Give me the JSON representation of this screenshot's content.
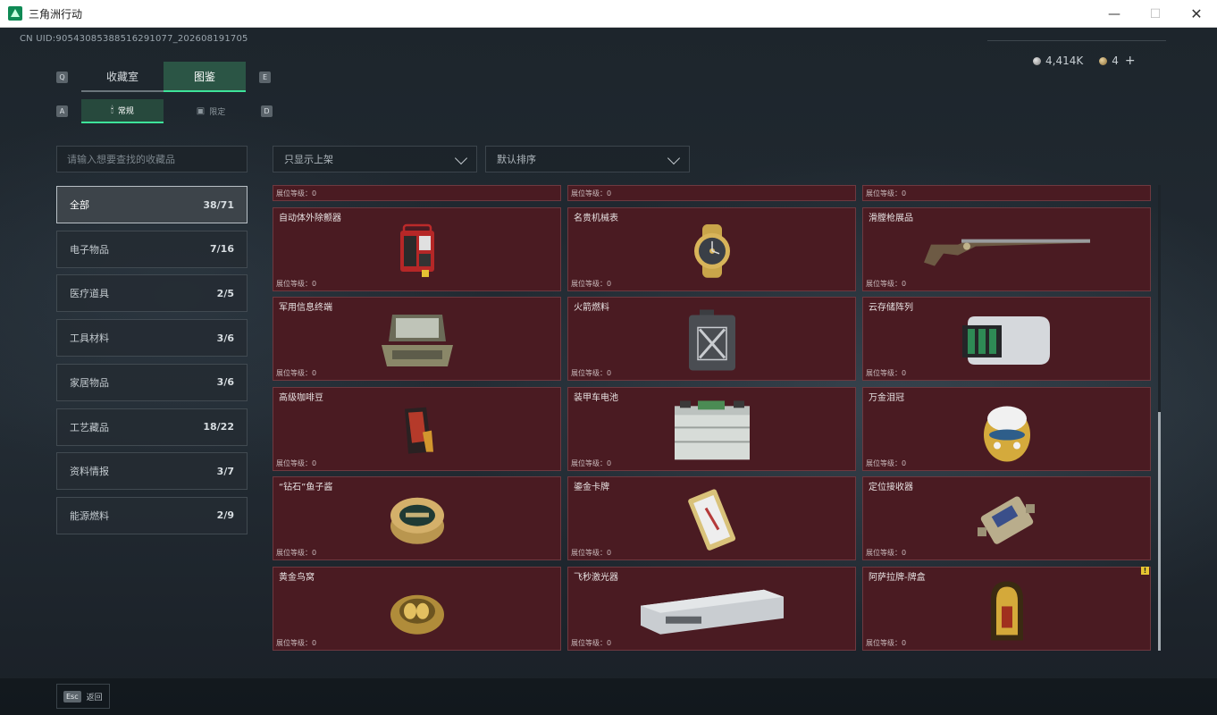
{
  "window": {
    "title": "三角洲行动"
  },
  "uid": "CN UID:9054308538851629​1077_202608191705",
  "currency": {
    "silver": "4,414K",
    "gold": "4",
    "plus": "+"
  },
  "keys": {
    "q": "Q",
    "e": "E",
    "a": "A",
    "d": "D"
  },
  "tabs": [
    {
      "label": "收藏室",
      "active": false
    },
    {
      "label": "图鉴",
      "active": true
    }
  ],
  "subtabs": [
    {
      "label": "常规",
      "icon": "🕯",
      "active": true
    },
    {
      "label": "限定",
      "icon": "▣",
      "active": false
    }
  ],
  "search": {
    "placeholder": "请输入想要查找的收藏品"
  },
  "filters": {
    "display": "只显示上架",
    "sort": "默认排序"
  },
  "categories": [
    {
      "label": "全部",
      "count": "38/71",
      "active": true
    },
    {
      "label": "电子物品",
      "count": "7/16"
    },
    {
      "label": "医疗道具",
      "count": "2/5"
    },
    {
      "label": "工具材料",
      "count": "3/6"
    },
    {
      "label": "家居物品",
      "count": "3/6"
    },
    {
      "label": "工艺藏品",
      "count": "18/22"
    },
    {
      "label": "资料情报",
      "count": "3/7"
    },
    {
      "label": "能源燃料",
      "count": "2/9"
    }
  ],
  "level_label": "展位等级：0",
  "items": [
    {
      "name": "",
      "icon": "partial",
      "partial": true
    },
    {
      "name": "",
      "icon": "partial",
      "partial": true
    },
    {
      "name": "",
      "icon": "partial",
      "partial": true
    },
    {
      "name": "自动体外除颤器",
      "icon": "defibrillator-icon"
    },
    {
      "name": "名贵机械表",
      "icon": "watch-icon"
    },
    {
      "name": "滑膛枪展品",
      "icon": "musket-icon"
    },
    {
      "name": "军用信息终端",
      "icon": "terminal-icon"
    },
    {
      "name": "火箭燃料",
      "icon": "fuel-can-icon"
    },
    {
      "name": "云存储阵列",
      "icon": "storage-array-icon"
    },
    {
      "name": "高级咖啡豆",
      "icon": "coffee-bag-icon"
    },
    {
      "name": "装甲车电池",
      "icon": "battery-icon"
    },
    {
      "name": "万金泪冠",
      "icon": "jewel-egg-icon"
    },
    {
      "name": "“钻石”鱼子酱",
      "icon": "caviar-tin-icon"
    },
    {
      "name": "鎏金卡牌",
      "icon": "gold-card-icon"
    },
    {
      "name": "定位接收器",
      "icon": "receiver-icon"
    },
    {
      "name": "黄金鸟窝",
      "icon": "bird-nest-icon"
    },
    {
      "name": "飞秒激光器",
      "icon": "laser-icon"
    },
    {
      "name": "阿萨拉牌-牌盒",
      "icon": "card-box-icon",
      "warning": "!"
    }
  ],
  "footer": {
    "esc": "Esc",
    "back": "返回"
  }
}
